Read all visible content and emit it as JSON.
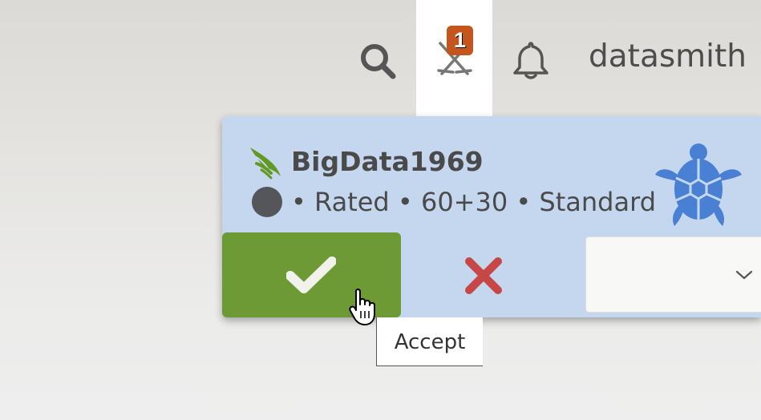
{
  "header": {
    "search_icon": "search-icon",
    "challenges_icon": "crossed-swords-icon",
    "challenge_count": "1",
    "notifications_icon": "bell-icon",
    "username": "datasmith"
  },
  "challenge": {
    "opponent_name": "BigData1969",
    "opponent_icon": "lichess-logo-icon",
    "color_icon": "random-color-circle-icon",
    "info": "• Rated • 60+30 • Standard",
    "speed_icon": "turtle-correspondence-icon",
    "accept_icon": "checkmark-icon",
    "decline_icon": "x-mark-icon",
    "decline_reason_value": "",
    "decline_reason_icon": "chevron-down-icon",
    "accept_tooltip": "Accept"
  },
  "colors": {
    "card_background": "#c4d7ef",
    "accept_green": "#6d9a35",
    "decline_red": "#c74747",
    "badge_orange": "#c4561d",
    "turtle_blue": "#4a80d3",
    "logo_green": "#629924",
    "icon_gray": "#555555"
  }
}
